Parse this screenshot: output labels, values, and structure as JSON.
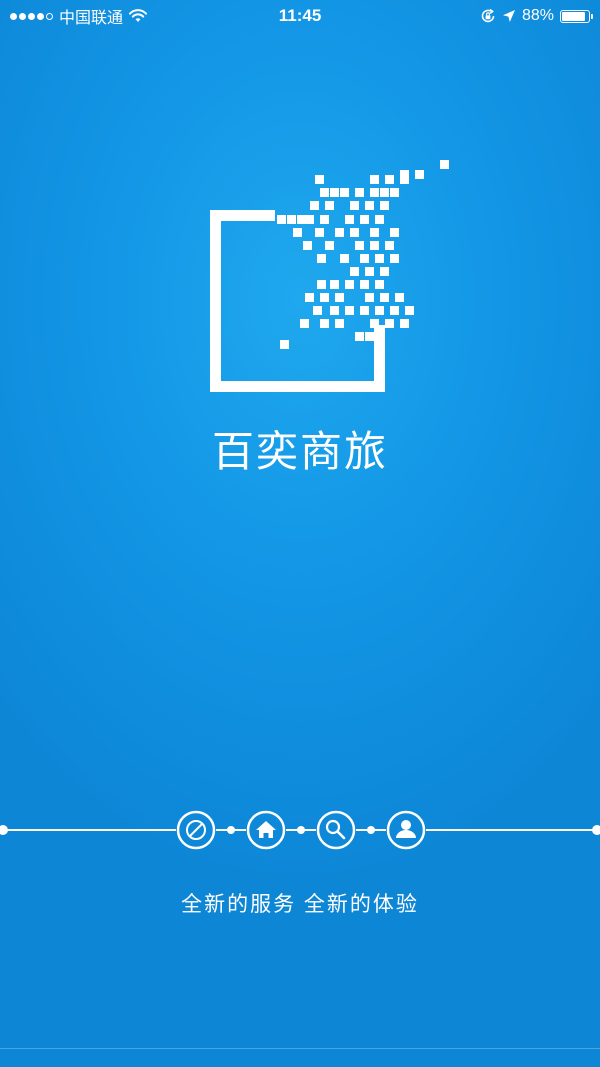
{
  "status_bar": {
    "carrier": "中国联通",
    "time": "11:45",
    "battery_percent": "88%",
    "battery_level": 0.88,
    "icons": [
      "signal-dots",
      "wifi-icon",
      "orientation-lock-icon",
      "location-arrow-icon",
      "battery-icon"
    ]
  },
  "splash": {
    "app_name": "百奕商旅",
    "tagline": "全新的服务 全新的体验",
    "nav_icons": [
      "compass-icon",
      "home-icon",
      "search-icon",
      "user-icon"
    ]
  },
  "colors": {
    "background": "#1397e6",
    "foreground": "#ffffff"
  }
}
